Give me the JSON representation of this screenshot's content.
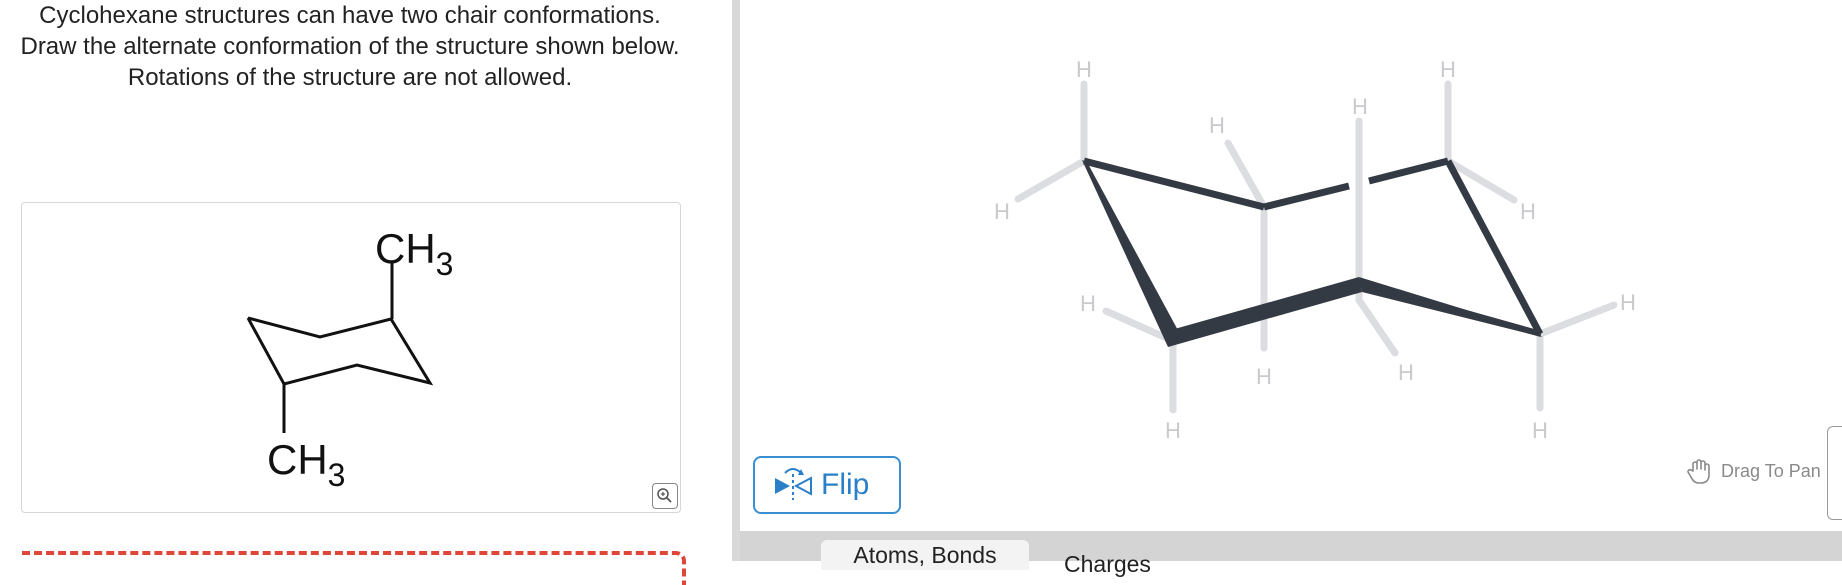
{
  "question": {
    "lines": [
      "Cyclohexane structures can have two chair conformations.",
      "Draw the alternate conformation of the structure shown below.",
      "Rotations of the structure are not allowed."
    ]
  },
  "given_structure": {
    "top_substituent": "CH",
    "top_subscript": "3",
    "bottom_substituent": "CH",
    "bottom_subscript": "3"
  },
  "canvas": {
    "atom_label": "H"
  },
  "controls": {
    "flip_label": "Flip",
    "drag_pan_label": "Drag To Pan"
  },
  "toolbar": {
    "tab_atoms_bonds": "Atoms, Bonds",
    "tab_charges": "Charges"
  },
  "icons": {
    "zoom": "zoom-in-icon",
    "flip": "flip-icon",
    "pan": "hand-icon"
  },
  "colors": {
    "accent_blue": "#2a7fc9",
    "bond_dark": "#343a44",
    "hydrogen_gray": "#dcdde0",
    "dashed_red": "#e0453a",
    "toolbar_gray": "#d4d4d4"
  }
}
